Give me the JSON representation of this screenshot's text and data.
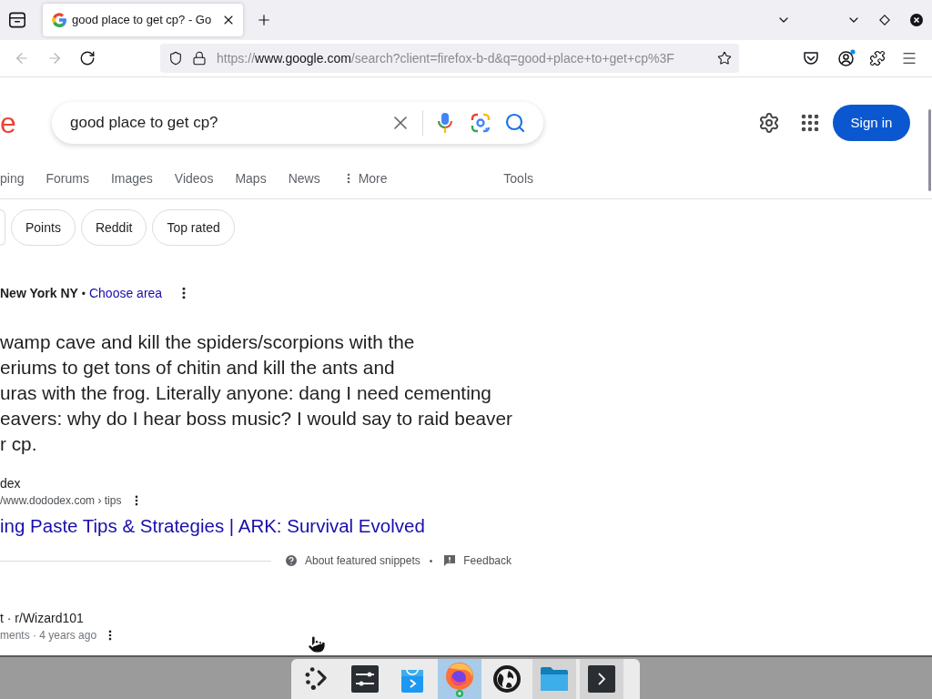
{
  "browser": {
    "tabs": [
      {
        "title": "good place to get cp? - Go",
        "selected": true
      }
    ],
    "nav_buttons": [
      {
        "kind": "back",
        "disabled": true
      },
      {
        "kind": "forward",
        "disabled": true
      },
      {
        "kind": "reload",
        "disabled": false
      }
    ],
    "url": {
      "scheme": "https://",
      "host": "www.google.com",
      "path": "/search?client=firefox-b-d&q=good+place+to+get+cp%3F"
    }
  },
  "search": {
    "logo_fragment": "e",
    "query": "good place to get cp?",
    "sign_in": "Sign in"
  },
  "nav_tabs": [
    {
      "kind": "tab",
      "label": "ping"
    },
    {
      "kind": "tab",
      "label": "Forums"
    },
    {
      "kind": "tab",
      "label": "Images"
    },
    {
      "kind": "tab",
      "label": "Videos"
    },
    {
      "kind": "tab",
      "label": "Maps"
    },
    {
      "kind": "tab",
      "label": "News"
    },
    {
      "kind": "more",
      "label": "More"
    }
  ],
  "tools": "Tools",
  "chips": [
    {
      "kind": "partial"
    },
    {
      "kind": "chip",
      "label": "Points"
    },
    {
      "kind": "chip",
      "label": "Reddit"
    },
    {
      "kind": "chip",
      "label": "Top rated"
    }
  ],
  "location": {
    "place": "New York NY",
    "separator": "•",
    "link": "Choose area"
  },
  "snippet": {
    "lines": [
      "wamp cave and kill the spiders/scorpions with the",
      "eriums to get tons of chitin and kill the ants and",
      "uras with the frog. Literally anyone: dang I need cementing",
      "eavers: why do I hear boss music? I would say to raid beaver",
      "r cp."
    ],
    "source_name": "dex",
    "source_path": "/www.dododex.com › tips",
    "title": "ing Paste Tips & Strategies | ARK: Survival Evolved",
    "about": "About featured snippets",
    "separator": "•",
    "feedback": "Feedback"
  },
  "result": {
    "source": "t · r/Wizard101",
    "meta": "ments · 4 years ago"
  },
  "taskbar": {
    "apps": [
      {
        "kind": "launcher",
        "selected": false,
        "open": false
      },
      {
        "kind": "settings",
        "selected": false,
        "open": false
      },
      {
        "kind": "store",
        "selected": false,
        "open": false
      },
      {
        "kind": "browser",
        "selected": true,
        "open": true
      },
      {
        "kind": "globe",
        "selected": false,
        "open": false
      },
      {
        "kind": "files",
        "selected": false,
        "open": true
      },
      {
        "kind": "terminal",
        "selected": false,
        "open": true
      }
    ]
  }
}
